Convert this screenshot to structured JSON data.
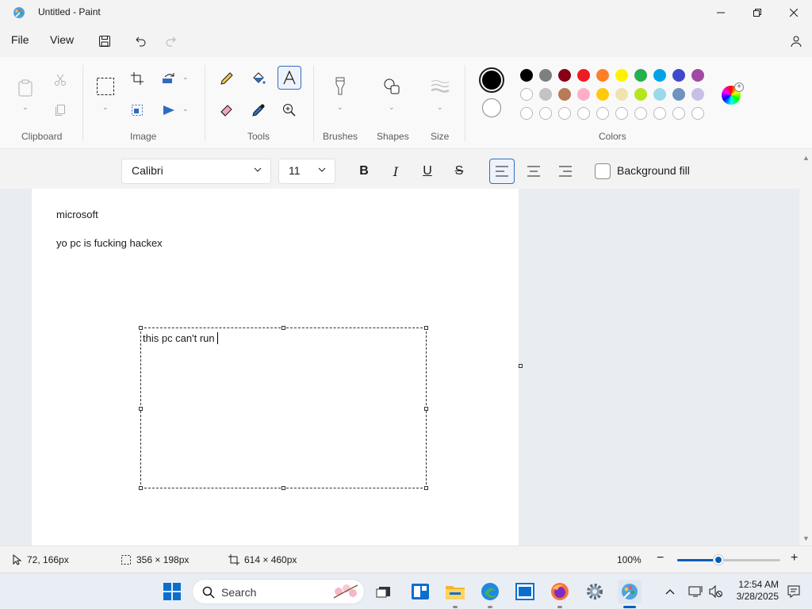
{
  "window": {
    "title": "Untitled - Paint"
  },
  "menu": {
    "file": "File",
    "view": "View"
  },
  "ribbon": {
    "groups": {
      "clipboard": "Clipboard",
      "image": "Image",
      "tools": "Tools",
      "brushes": "Brushes",
      "shapes": "Shapes",
      "size": "Size",
      "colors": "Colors"
    },
    "colors": {
      "color1": "#000000",
      "color2": "#ffffff",
      "row1": [
        "#000000",
        "#7f7f7f",
        "#880015",
        "#ed1c24",
        "#ff7f27",
        "#fff200",
        "#22b14c",
        "#00a2e8",
        "#3f48cc",
        "#a349a4"
      ],
      "row2": [
        "#ffffff",
        "#c3c3c3",
        "#b97a57",
        "#ffaec9",
        "#ffc90e",
        "#efe4b0",
        "#b5e61d",
        "#99d9ea",
        "#7092be",
        "#c8bfe7"
      ]
    }
  },
  "text_toolbar": {
    "font": "Calibri",
    "size": "11",
    "bold": "B",
    "italic": "I",
    "underline": "U",
    "strike": "S",
    "background_fill": "Background fill"
  },
  "canvas": {
    "line1": "microsoft",
    "line2": "yo pc is fucking hackex",
    "textbox_text": "this pc can't run"
  },
  "status": {
    "cursor_pos": "72, 166px",
    "selection_size": "356 × 198px",
    "canvas_size": "614 × 460px",
    "zoom": "100%",
    "zoom_level": 0.4
  },
  "taskbar": {
    "search_placeholder": "Search",
    "time": "12:54 AM",
    "date": "3/28/2025"
  }
}
